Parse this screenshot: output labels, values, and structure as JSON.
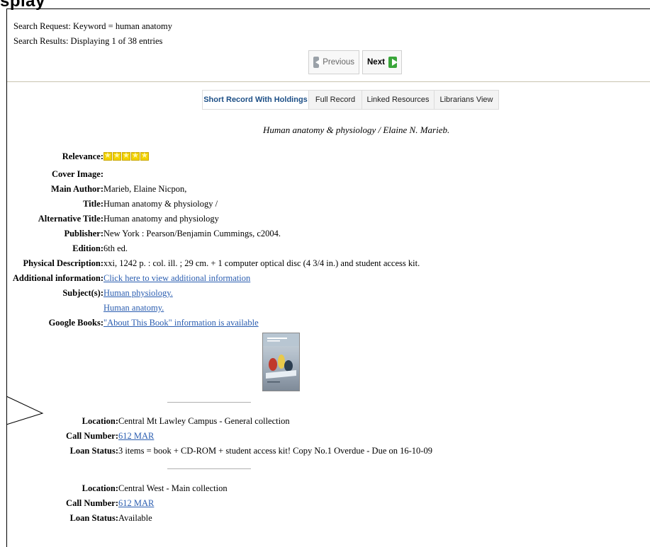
{
  "page": {
    "heading": "splay"
  },
  "search": {
    "request": "Search Request: Keyword = human anatomy",
    "results": "Search Results: Displaying 1 of 38 entries"
  },
  "pager": {
    "previous": "Previous",
    "next": "Next"
  },
  "tabs": [
    {
      "label": "Short Record With Holdings",
      "active": true
    },
    {
      "label": "Full Record",
      "active": false
    },
    {
      "label": "Linked Resources",
      "active": false
    },
    {
      "label": "Librarians View",
      "active": false
    }
  ],
  "record": {
    "title": "Human anatomy & physiology / Elaine N. Marieb.",
    "relevance_label": "Relevance:",
    "relevance_stars": 5,
    "cover_label": "Cover Image:",
    "author_label": "Main Author:",
    "author": "Marieb, Elaine Nicpon,",
    "title_label": "Title:",
    "title_value": "Human anatomy & physiology /",
    "alt_title_label": "Alternative Title:",
    "alt_title": "Human anatomy and physiology",
    "publisher_label": "Publisher:",
    "publisher": "New York : Pearson/Benjamin Cummings, c2004.",
    "edition_label": "Edition:",
    "edition": "6th ed.",
    "physical_label": "Physical Description:",
    "physical": "xxi, 1242 p. : col. ill. ; 29 cm. + 1 computer optical disc (4 3/4 in.) and student access kit.",
    "additional_label": "Additional information:",
    "additional_link": "Click here to view additional information",
    "subjects_label": "Subject(s):",
    "subjects": [
      "Human physiology.",
      "Human anatomy."
    ],
    "google_label": "Google Books:",
    "google_link": "\"About This Book\" information is available"
  },
  "holdings": [
    {
      "location_label": "Location:",
      "location": "Central Mt Lawley Campus - General collection",
      "call_label": "Call Number:",
      "call": "612 MAR",
      "loan_label": "Loan Status:",
      "loan": "3 items = book + CD-ROM + student access kit! Copy No.1 Overdue - Due on 16-10-09"
    },
    {
      "location_label": "Location:",
      "location": "Central West - Main collection",
      "call_label": "Call Number:",
      "call": "612 MAR",
      "loan_label": "Loan Status:",
      "loan": "Available"
    }
  ],
  "colors": {
    "link": "#2a5db0",
    "active_tab": "#1d4f86",
    "next_arrow": "#3aa63a",
    "star": "#f2d200"
  }
}
